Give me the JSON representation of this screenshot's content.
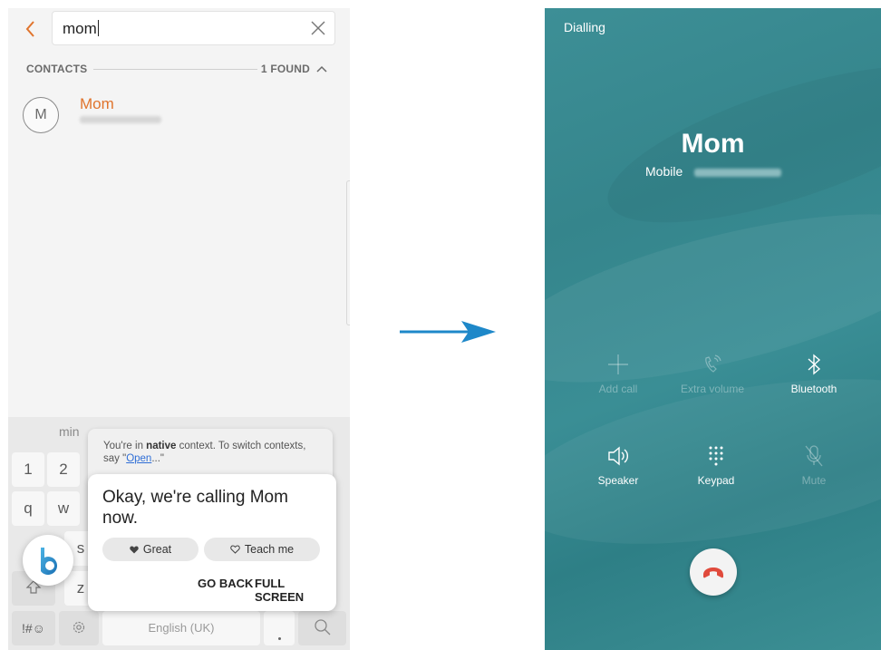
{
  "search": {
    "query": "mom"
  },
  "contacts": {
    "header": "CONTACTS",
    "found": "1 FOUND"
  },
  "contact": {
    "initial": "M",
    "name": "Mom"
  },
  "keyboard": {
    "suggestion": "min",
    "row_numbers": [
      "1",
      "2"
    ],
    "row_q": [
      "q",
      "w"
    ],
    "row_a": [
      "s"
    ],
    "row_z": [
      "z"
    ],
    "symbols_key": "!#☺",
    "space_label": "English (UK)"
  },
  "bixby": {
    "context_pre": "You're in ",
    "context_bold": "native",
    "context_mid": " context. To switch contexts, say \"",
    "context_link": "Open",
    "context_post": "...\"",
    "reply": "Okay, we're calling Mom now.",
    "great_label": "Great",
    "teach_label": "Teach me",
    "go_back_label": "GO BACK",
    "full_screen_label": "FULL SCREEN"
  },
  "call": {
    "status": "Dialling",
    "name": "Mom",
    "type": "Mobile",
    "buttons": {
      "add_call": "Add call",
      "extra_volume": "Extra volume",
      "bluetooth": "Bluetooth",
      "speaker": "Speaker",
      "keypad": "Keypad",
      "mute": "Mute"
    }
  },
  "colors": {
    "accent_orange": "#e0742d",
    "call_bg": "#36868d",
    "arrow_blue": "#1e88c9",
    "end_call_red": "#e04a3c"
  }
}
